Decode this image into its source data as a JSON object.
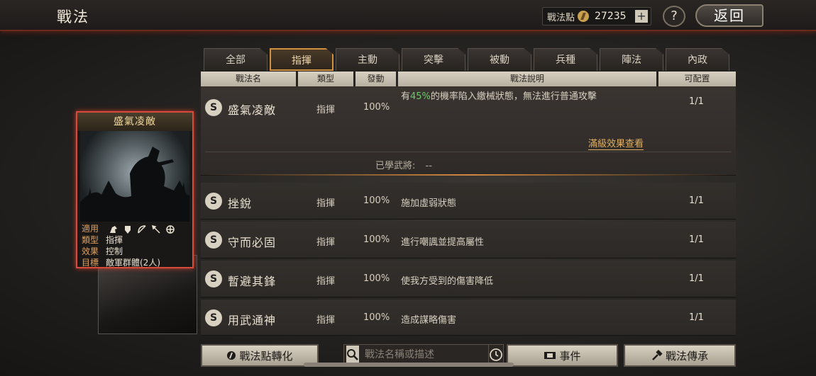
{
  "header": {
    "title": "戰法",
    "points_label": "戰法點",
    "points_value": "27235",
    "plus_label": "+",
    "help_label": "?",
    "back_label": "返回"
  },
  "tabs": [
    "全部",
    "指揮",
    "主動",
    "突擊",
    "被動",
    "兵種",
    "陣法",
    "內政"
  ],
  "active_tab": "指揮",
  "columns": [
    "戰法名",
    "類型",
    "發動",
    "戰法說明",
    "可配置"
  ],
  "expanded_row": {
    "grade": "S",
    "name": "盛氣凌敵",
    "type": "指揮",
    "rate": "100%",
    "desc_prefix": "有",
    "desc_highlight": "45%",
    "desc_suffix": "的機率陷入繳械狀態，無法進行普通攻擊",
    "slots": "1/1",
    "full_effect_link": "滿級效果查看",
    "learned_label": "已學武將:",
    "learned_value": "--"
  },
  "rows": [
    {
      "grade": "S",
      "name": "挫銳",
      "type": "指揮",
      "rate": "100%",
      "desc": "施加虛弱狀態",
      "slots": "1/1"
    },
    {
      "grade": "S",
      "name": "守而必固",
      "type": "指揮",
      "rate": "100%",
      "desc": "進行嘲諷並提高屬性",
      "slots": "1/1"
    },
    {
      "grade": "S",
      "name": "暫避其鋒",
      "type": "指揮",
      "rate": "100%",
      "desc": "使我方受到的傷害降低",
      "slots": "1/1"
    },
    {
      "grade": "S",
      "name": "用武通神",
      "type": "指揮",
      "rate": "100%",
      "desc": "造成謀略傷害",
      "slots": "1/1"
    }
  ],
  "card": {
    "title": "盛氣凌敵",
    "applies_label": "適用",
    "type_label": "類型",
    "type_value": "指揮",
    "effect_label": "效果",
    "effect_value": "控制",
    "target_label": "目標",
    "target_value": "敵軍群體(2人)",
    "unit_icons": [
      "cavalry-icon",
      "shield-icon",
      "bow-icon",
      "spear-icon",
      "siege-icon"
    ]
  },
  "bottom": {
    "convert_label": "戰法點轉化",
    "search_placeholder": "戰法名稱或描述",
    "events_label": "事件",
    "inherit_label": "戰法傳承"
  },
  "colors": {
    "accent": "#d09040",
    "highlight_green": "#6ec86e",
    "card_border": "#d84a3a"
  }
}
